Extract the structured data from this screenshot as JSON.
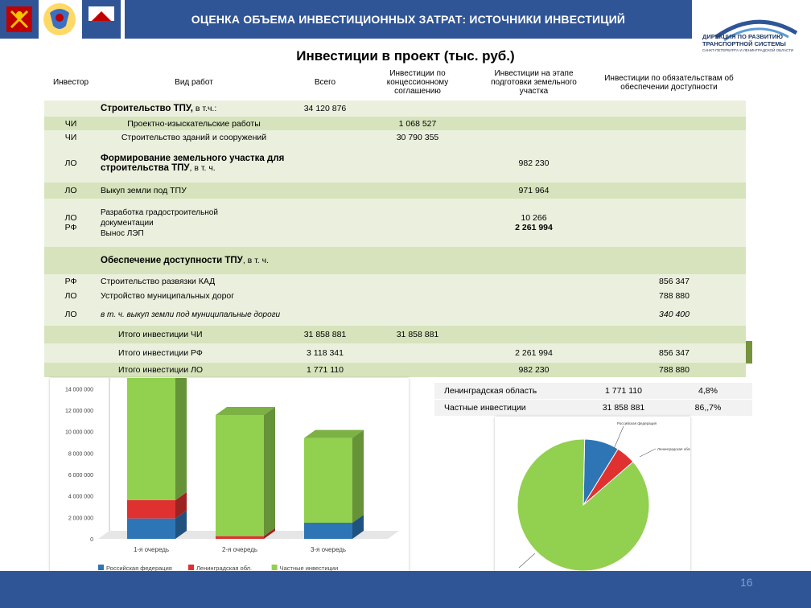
{
  "header": {
    "title": "ОЦЕНКА ОБЪЕМА ИНВЕСТИЦИОННЫХ ЗАТРАТ: ИСТОЧНИКИ ИНВЕСТИЦИЙ",
    "org_line1": "ДИРЕКЦИЯ ПО РАЗВИТИЮ",
    "org_line2": "ТРАНСПОРТНОЙ СИСТЕМЫ",
    "org_line3": "САНКТ-ПЕТЕРБУРГА И ЛЕНИНГРАДСКОЙ ОБЛАСТИ"
  },
  "page_title": "Инвестиции в проект (тыс. руб.)",
  "table": {
    "headers": {
      "investor": "Инвестор",
      "work": "Вид работ",
      "total": "Всего",
      "concession": "Инвестиции по концессионному соглашению",
      "land": "Инвестиции на этапе подготовки земельного участка",
      "obligations": "Инвестиции по обязательствам об обеспечении доступности"
    },
    "rows": [
      {
        "investor": "",
        "work_bold": "Строительство ТПУ,",
        "work_rest": " в т.ч.:",
        "total": "34 120 876",
        "concession": "",
        "land": "",
        "obligations": ""
      },
      {
        "investor": "ЧИ",
        "work": "Проектно-изыскательские работы",
        "total": "",
        "concession": "1 068 527",
        "land": "",
        "obligations": ""
      },
      {
        "investor": "ЧИ",
        "work": "Строительство зданий и сооружений",
        "total": "",
        "concession": "30 790 355",
        "land": "",
        "obligations": ""
      },
      {
        "investor": "ЛО",
        "work_bold": "Формирование земельного участка для строительства ТПУ",
        "work_rest": ", в т. ч.",
        "total": "",
        "concession": "",
        "land": "982 230",
        "obligations": ""
      },
      {
        "investor": "ЛО",
        "work": "Выкуп земли под ТПУ",
        "total": "",
        "concession": "",
        "land": "971 964",
        "obligations": ""
      },
      {
        "investor1": "ЛО",
        "investor2": "РФ",
        "work1": "Разработка градостроительной",
        "work2": "документации",
        "work3": "Вынос ЛЭП",
        "total": "",
        "concession": "",
        "land1": "10 266",
        "land2": "2 261 994",
        "obligations": ""
      },
      {
        "investor": "",
        "work_bold": "Обеспечение доступности ТПУ",
        "work_rest": ", в т. ч.",
        "total": "",
        "concession": "",
        "land": "",
        "obligations": ""
      },
      {
        "investor": "РФ",
        "work": "Строительство развязки КАД",
        "total": "",
        "concession": "",
        "land": "",
        "obligations": "856 347"
      },
      {
        "investor": "ЛО",
        "work": "Устройство муниципальных дорог",
        "total": "",
        "concession": "",
        "land": "",
        "obligations": "788 880"
      },
      {
        "investor": "ЛО",
        "work": "в т. ч. выкуп земли под муниципальные дороги",
        "total": "",
        "concession": "",
        "land": "",
        "obligations": "340 400"
      },
      {
        "label": "Итого инвестиции ЧИ",
        "total": "31 858 881",
        "concession": "31 858 881",
        "land": "",
        "obligations": ""
      },
      {
        "label": "Итого инвестиции РФ",
        "total": "3 118 341",
        "concession": "",
        "land": "2 261 994",
        "obligations": "856 347"
      },
      {
        "label": "Итого инвестиции ЛО",
        "total": "1 771 110",
        "concession": "",
        "land": "982 230",
        "obligations": "788 880"
      }
    ]
  },
  "summary": [
    {
      "name": "Ленинградская область",
      "value": "1 771 110",
      "share": "4,8%"
    },
    {
      "name": "Частные инвестиции",
      "value": "31 858 881",
      "share": "86,,7%"
    }
  ],
  "chart_data": [
    {
      "type": "bar",
      "stacked": true,
      "categories": [
        "1-я очередь",
        "2-я очередь",
        "3-я очередь"
      ],
      "series": [
        {
          "name": "Российская федерация",
          "color": "#2e75b6",
          "values": [
            1900000,
            0,
            1500000
          ]
        },
        {
          "name": "Ленинградская обл.",
          "color": "#e03131",
          "values": [
            1700000,
            250000,
            0
          ]
        },
        {
          "name": "Частные инвестиции",
          "color": "#92d050",
          "values": [
            11400000,
            11300000,
            7900000
          ]
        }
      ],
      "yticks": [
        "0",
        "2 000 000",
        "4 000 000",
        "6 000 000",
        "8 000 000",
        "10 000 000",
        "12 000 000",
        "14 000 000"
      ],
      "ylim": [
        0,
        15000000
      ]
    },
    {
      "type": "pie",
      "slices": [
        {
          "label": "Российская федерация",
          "value": 8.5,
          "color": "#2e75b6"
        },
        {
          "label": "Ленинградская область",
          "value": 4.8,
          "color": "#e03131"
        },
        {
          "label": "",
          "value": 86.7,
          "color": "#92d050"
        }
      ],
      "label_other": "Частные инвестиции"
    }
  ],
  "page_number": "16"
}
